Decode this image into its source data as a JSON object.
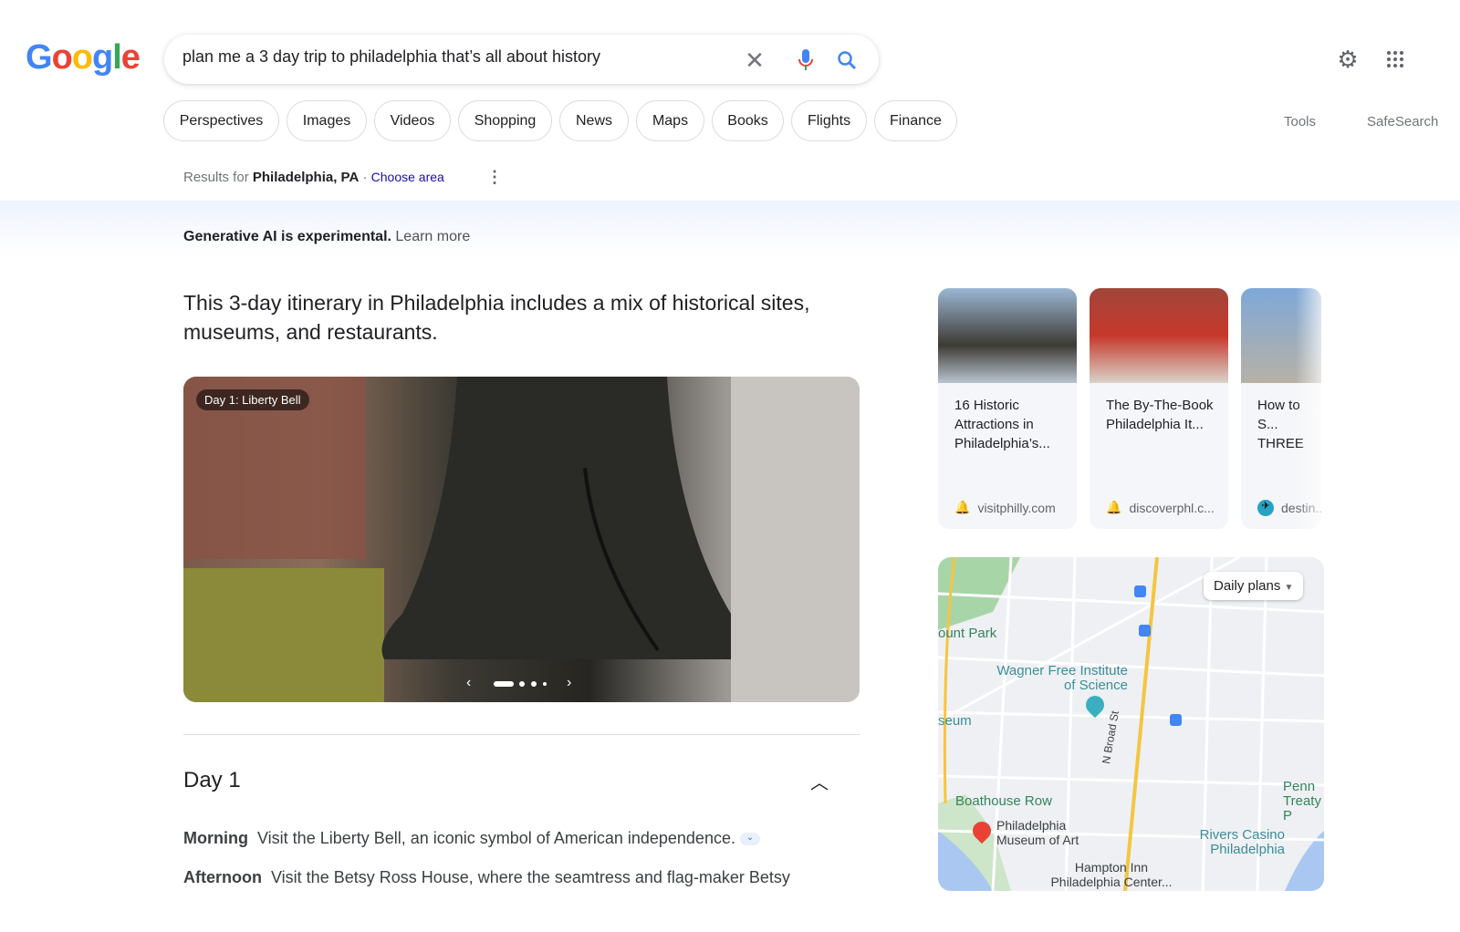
{
  "header": {
    "logo": "Google",
    "query": "plan me a 3 day trip to philadelphia that’s all about history"
  },
  "chips": [
    "Perspectives",
    "Images",
    "Videos",
    "Shopping",
    "News",
    "Maps",
    "Books",
    "Flights",
    "Finance"
  ],
  "tools": "Tools",
  "safesearch": "SafeSearch",
  "location": {
    "prefix": "Results for",
    "place": "Philadelphia, PA",
    "sep": "·",
    "choose": "Choose area"
  },
  "ai_notice": {
    "bold": "Generative AI is experimental.",
    "link": "Learn more"
  },
  "summary": "This 3-day itinerary in Philadelphia includes a mix of historical sites, museums, and restaurants.",
  "hero": {
    "caption": "Day 1: Liberty Bell",
    "slides": 4,
    "active_slide": 1
  },
  "day": {
    "title": "Day 1",
    "items": [
      {
        "label": "Morning",
        "text": "Visit the Liberty Bell, an iconic symbol of American independence."
      },
      {
        "label": "Afternoon",
        "text": "Visit the Betsy Ross House, where the seamtress and flag-maker Betsy"
      }
    ]
  },
  "cards": [
    {
      "title": "16 Historic Attractions in Philadelphia’s...",
      "source": "visitphilly.com",
      "icon_color": "#e8553e"
    },
    {
      "title": "The By-The-Book Philadelphia It...",
      "source": "discoverphl.c...",
      "icon_color": "#2f9e5b"
    },
    {
      "title": "How to S... THREE D... Philadelp...",
      "source": "destin...",
      "icon_color": "#1a73e8"
    }
  ],
  "map": {
    "dropdown": "Daily plans",
    "labels": [
      "ount Park",
      "Wagner Free Institute of Science",
      "seum",
      "N Broad St",
      "Boathouse Row",
      "Philadelphia Museum of Art",
      "Rivers Casino Philadelphia",
      "Hampton Inn Philadelphia Center...",
      "Penn Treaty P"
    ]
  }
}
